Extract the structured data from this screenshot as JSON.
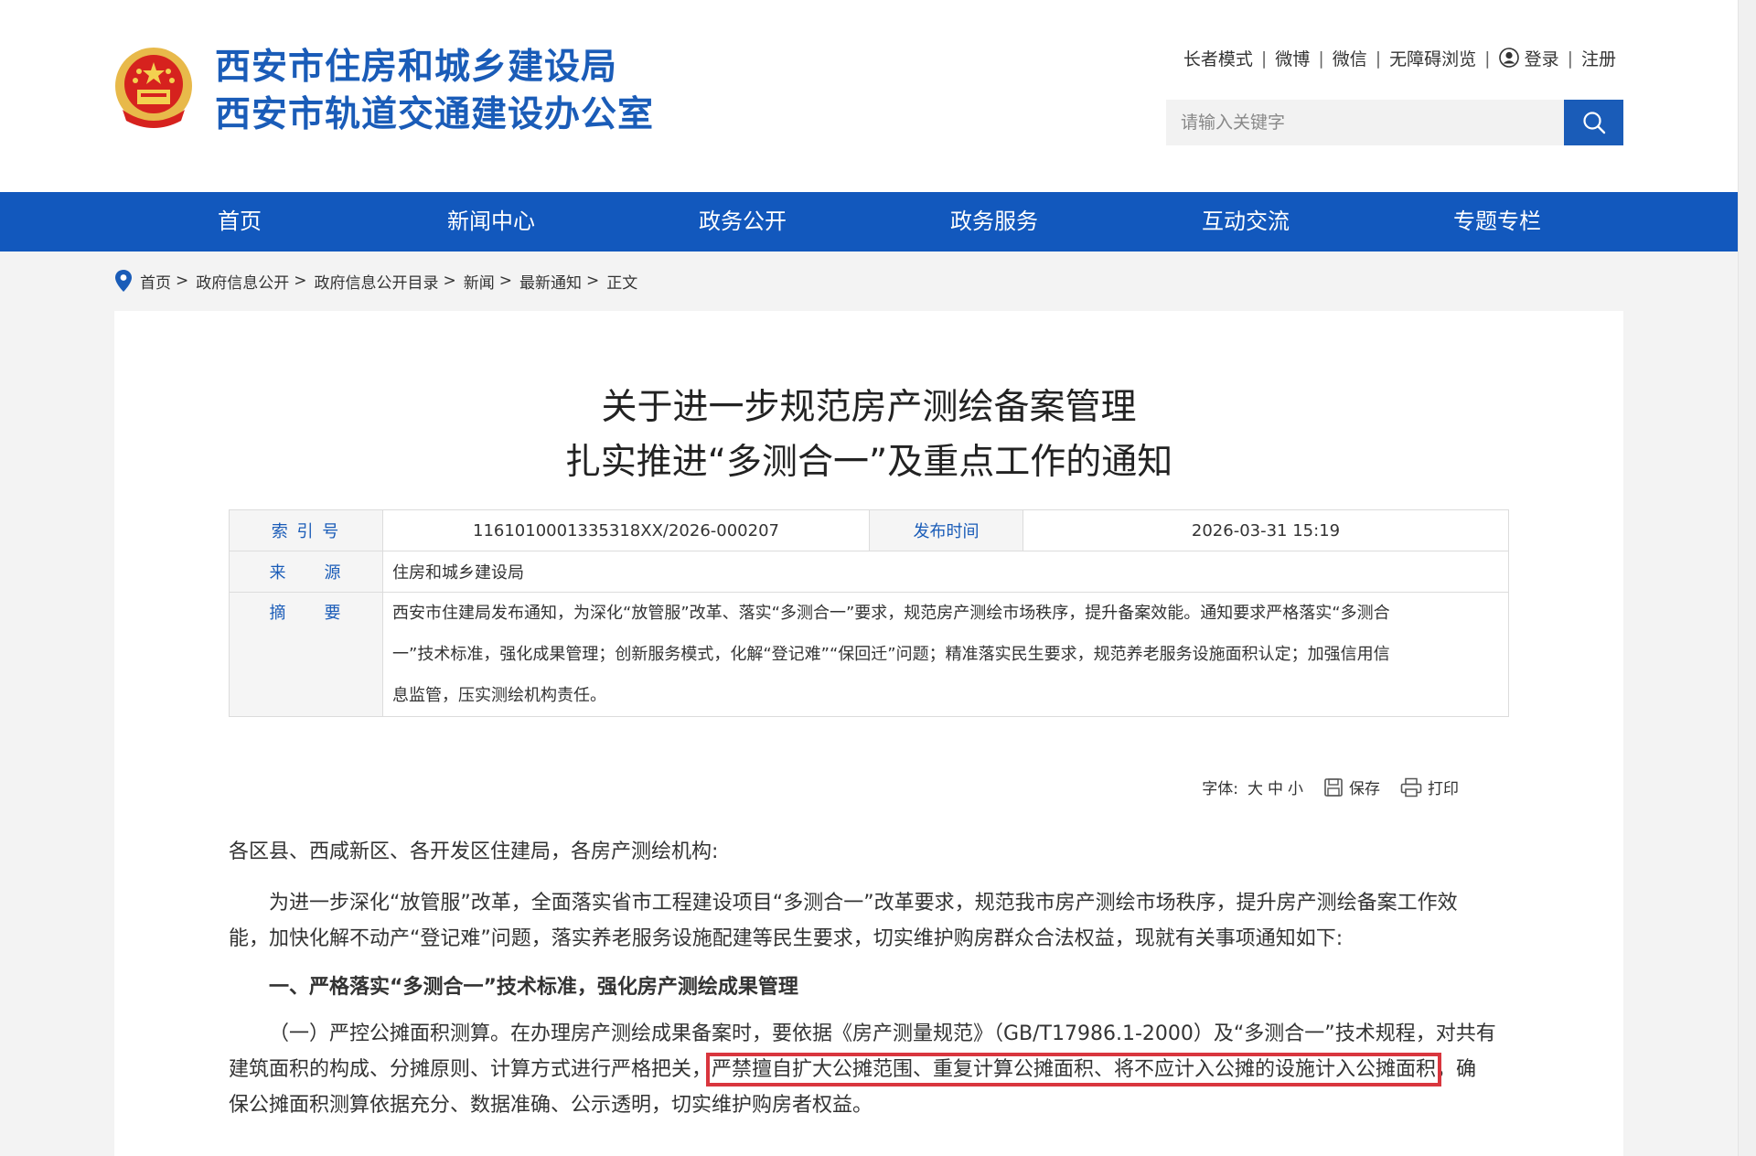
{
  "header": {
    "title_line1": "西安市住房和城乡建设局",
    "title_line2": "西安市轨道交通建设办公室",
    "top_links": [
      "长者模式",
      "微博",
      "微信",
      "无障碍浏览",
      "登录",
      "注册"
    ],
    "separator": "|",
    "search_placeholder": "请输入关键字"
  },
  "nav": {
    "items": [
      "首页",
      "新闻中心",
      "政务公开",
      "政务服务",
      "互动交流",
      "专题专栏"
    ]
  },
  "breadcrumb": {
    "items": [
      "首页",
      "政府信息公开",
      "政府信息公开目录",
      "新闻",
      "最新通知",
      "正文"
    ],
    "separator": ">"
  },
  "article": {
    "title_line1": "关于进一步规范房产测绘备案管理",
    "title_line2": "扎实推进“多测合一”及重点工作的通知",
    "meta": {
      "index_label": "索 引 号",
      "index_value": "1161010001335318XX/2026-000207",
      "publish_label": "发布时间",
      "publish_value": "2026-03-31 15:19",
      "source_label": "来　　源",
      "source_value": "住房和城乡建设局",
      "abstract_label": "摘　　要",
      "abstract_lines": [
        "西安市住建局发布通知，为深化“放管服”改革、落实“多测合一”要求，规范房产测绘市场秩序，提升备案效能。通知要求严格落实“多测合",
        "一”技术标准，强化成果管理；创新服务模式，化解“登记难”“保回迁”问题；精准落实民生要求，规范养老服务设施面积认定；加强信用信",
        "息监管，压实测绘机构责任。"
      ]
    },
    "tools": {
      "font_label": "字体:",
      "sizes": [
        "大",
        "中",
        "小"
      ],
      "save": "保存",
      "print": "打印"
    },
    "salutation": "各区县、西咸新区、各开发区住建局，各房产测绘机构:",
    "para1_line1": "为进一步深化“放管服”改革，全面落实省市工程建设项目“多测合一”改革要求，规范我市房产测绘市场秩序，提升房产测绘备案工作效",
    "para1_line2": "能，加快化解不动产“登记难”问题，落实养老服务设施配建等民生要求，切实维护购房群众合法权益，现就有关事项通知如下:",
    "section1": "一、严格落实“多测合一”技术标准，强化房产测绘成果管理",
    "para2_line1": "（一）严控公摊面积测算。在办理房产测绘成果备案时，要依据《房产测量规范》（GB/T17986.1-2000）及“多测合一”技术规程，对共有",
    "para2_line2_pre": "建筑面积的构成、分摊原则、计算方式进行严格把关，",
    "para2_line2_hl": "严禁擅自扩大公摊范围、重复计算公摊面积、将不应计入公摊的设施计入公摊面积",
    "para2_line2_post": "，确",
    "para2_line3": "保公摊面积测算依据充分、数据准确、公示透明，切实维护购房者权益。"
  },
  "colors": {
    "brand_blue": "#1258bd",
    "title_blue": "#1a5cb8",
    "highlight_red": "#d9363e"
  },
  "icons": [
    "national-emblem-icon",
    "user-icon",
    "search-icon",
    "location-pin-icon",
    "save-icon",
    "print-icon"
  ]
}
